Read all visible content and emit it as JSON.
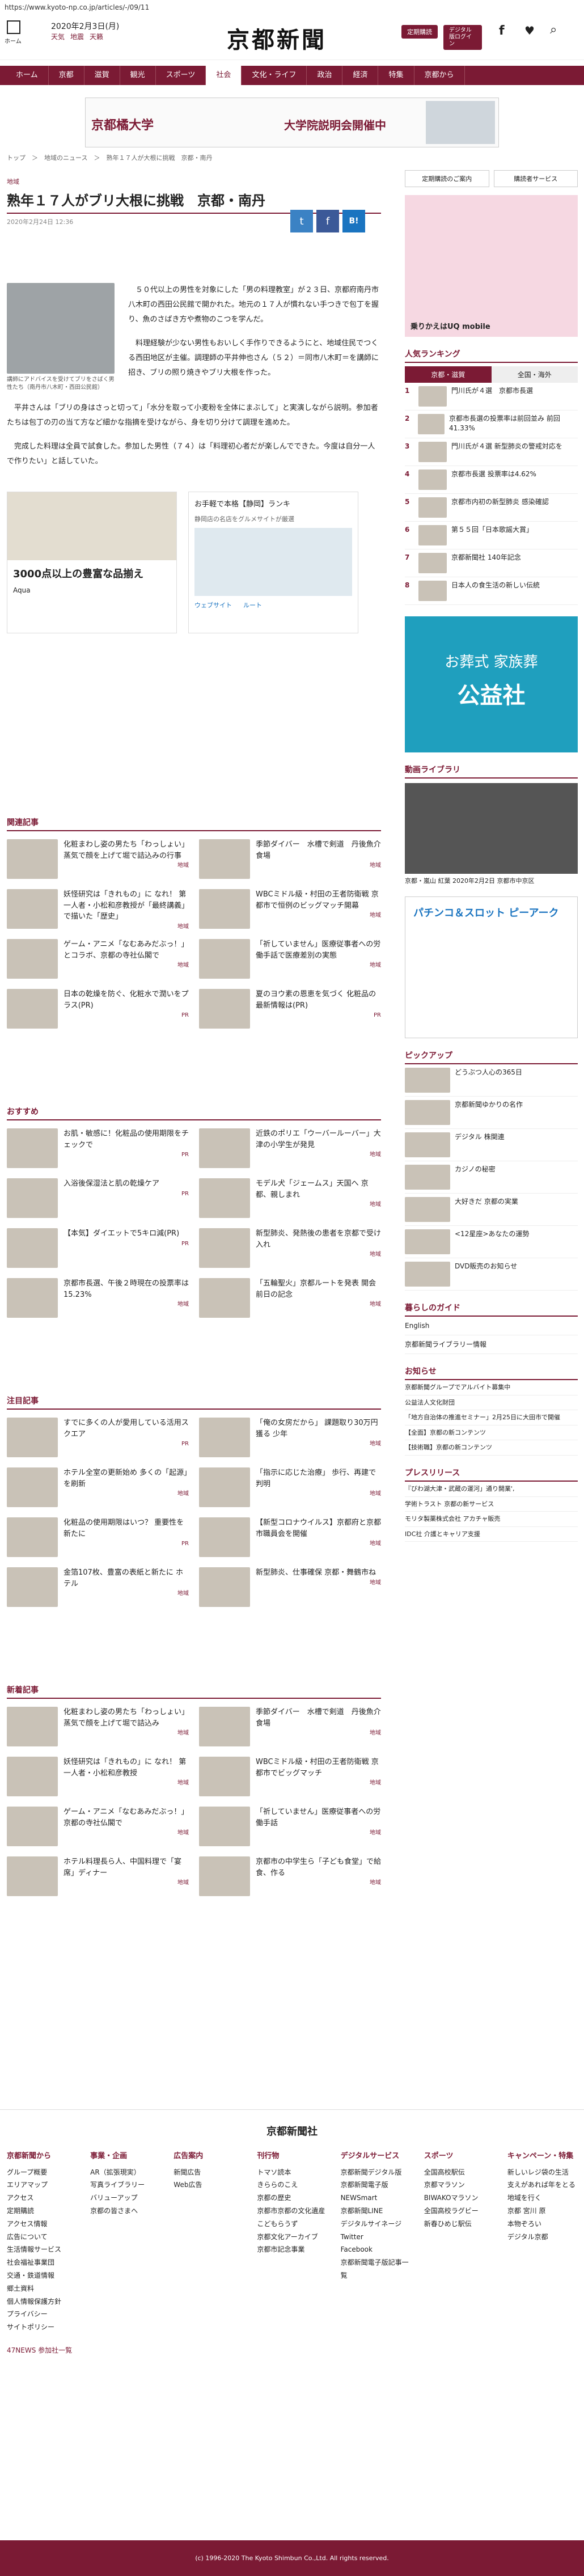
{
  "browser": {
    "url": "https://www.kyoto-np.co.jp/articles/-/09/11"
  },
  "header": {
    "date": "2020年2月3日(月)",
    "weather": [
      "天気",
      "地震",
      "天籁"
    ],
    "home_label": "ホーム",
    "brand": "京都新聞",
    "btn_subscribe": "定期購読",
    "btn_digital": "デジタル版ログイン",
    "social": [
      "Facebook",
      "Twitter",
      "Search"
    ]
  },
  "nav": {
    "items": [
      "ホーム",
      "京都",
      "滋賀",
      "観光",
      "スポーツ",
      "社会",
      "文化・ライフ",
      "政治",
      "経済",
      "特集",
      "京都から"
    ]
  },
  "banner": {
    "left": "京都橘大学",
    "middle": "大学院説明会開催中"
  },
  "breadcrumb": "トップ　＞　地域のニュース　＞　熟年１７人が大根に挑戦　京都・南丹",
  "article": {
    "category": "地域",
    "title": "熟年１７人がブリ大根に挑戦　京都・南丹",
    "date": "2020年2月24日 12:36",
    "share": [
      "f",
      "t",
      "B!"
    ],
    "photo_caption": "講師にアドバイスを受けてブリをさばく男性たち（南丹市八木町・西田公民館）",
    "paragraphs": [
      "５０代以上の男性を対象にした「男の料理教室」が２３日、京都府南丹市八木町の西田公民館で開かれた。地元の１７人が慣れない手つきで包丁を握り、魚のさばき方や煮物のこつを学んだ。",
      "料理経験が少ない男性もおいしく手作りできるようにと、地域住民でつくる西田地区が主催。調理師の平井伸也さん（５２）＝同市八木町＝を講師に招き、ブリの照り焼きやブリ大根を作った。",
      "平井さんは「ブリの身はさっと切って」「水分を取って小麦粉を全体にまぶして」と実演しながら説明。参加者たちは包丁の刃の当て方など細かな指摘を受けながら、身を切り分けて調理を進めた。",
      "完成した料理は全員で試食した。参加した男性（７４）は「料理初心者だが楽しんでできた。今度は自分一人で作りたい」と話していた。"
    ]
  },
  "ads": {
    "left_title": "3000点以上の豊富な品揃え",
    "left_brand": "Aqua",
    "right_title": "お手軽で本格【静岡】ランキ",
    "right_sub": "静岡店の名店をグルメサイトが厳選",
    "right_btn": [
      "ウェブサイト",
      "ルート"
    ]
  },
  "related": {
    "title": "関連記事",
    "items": [
      {
        "text": "化粧まわし姿の男たち「わっしょい」 蒸気で顔を上げて堀で詰込みの行事",
        "tag": "地域"
      },
      {
        "text": "季節ダイバー　水槽で剣道　丹後魚介食場",
        "tag": "地域"
      },
      {
        "text": "妖怪研究は「きれもの」に なれ！ 第一人者・小松和彦教授が「最終講義」で描いた「歴史」",
        "tag": "地域"
      },
      {
        "text": "WBCミドル級・村田の王者防衛戦 京都市で恒例のビッグマッチ開幕",
        "tag": "地域"
      },
      {
        "text": "ゲーム・アニメ「なむあみだぶっ！」 とコラボ、京都の寺社仏閣で",
        "tag": "地域"
      },
      {
        "text": "「祈していません」医療従事者への労働手話で医療差別の実態",
        "tag": "地域"
      },
      {
        "text": "日本の乾燥を防ぐ、化粧水で潤いをプラス(PR)",
        "tag": "PR"
      },
      {
        "text": "夏のヨウ素の恩恵を気づく 化粧品の最新情報は(PR)",
        "tag": "PR"
      }
    ]
  },
  "recommend": {
    "title": "おすすめ",
    "items": [
      {
        "text": "お肌・敏感に！化粧品の使用期限をチェックで",
        "tag": "PR"
      },
      {
        "text": "近鉄のポリエ「ウーバールーバー」大津の小学生が発見",
        "tag": "地域"
      },
      {
        "text": "入浴後保湿法と肌の乾燥ケア",
        "tag": "PR"
      },
      {
        "text": "モデル犬「ジェームス」天国へ 京都、親しまれ",
        "tag": "地域"
      },
      {
        "text": "【本気】ダイエットで5キロ減(PR)",
        "tag": "PR"
      },
      {
        "text": "新型肺炎、発熱後の患者を京都で受け入れ",
        "tag": "地域"
      },
      {
        "text": "京都市長選、午後２時現在の投票率は15.23%",
        "tag": "地域"
      },
      {
        "text": "「五輪聖火」京都ルートを発表 開会前日の記念",
        "tag": "地域"
      }
    ]
  },
  "featured": {
    "title": "注目記事",
    "items": [
      {
        "text": "すでに多くの人が愛用している活用スクエア",
        "tag": "PR"
      },
      {
        "text": "「俺の女房だから」 課題取り30万円獲る 少年",
        "tag": "地域"
      },
      {
        "text": "ホテル全室の更新始め 多くの「起源」を刷新",
        "tag": "地域"
      },
      {
        "text": "「指示に応じた治療」 歩行、再建で判明",
        "tag": "地域"
      },
      {
        "text": "化粧品の使用期限はいつ？ 重要性を新たに",
        "tag": "PR"
      },
      {
        "text": "【新型コロナウイルス】京都府と京都市職員会を開催",
        "tag": "地域"
      },
      {
        "text": "金箔107枚、豊富の表紙と新たに ホテル",
        "tag": "地域"
      },
      {
        "text": "新型肺炎、仕事確保 京都・舞鶴市ね",
        "tag": "地域"
      }
    ]
  },
  "latest": {
    "title": "新着記事",
    "items": [
      {
        "text": "化粧まわし姿の男たち「わっしょい」 蒸気で顔を上げて堀で詰込み",
        "tag": "地域"
      },
      {
        "text": "季節ダイバー　水槽で剣道　丹後魚介食場",
        "tag": "地域"
      },
      {
        "text": "妖怪研究は「きれもの」に なれ！ 第一人者・小松和彦教授",
        "tag": "地域"
      },
      {
        "text": "WBCミドル級・村田の王者防衛戦 京都市でビッグマッチ",
        "tag": "地域"
      },
      {
        "text": "ゲーム・アニメ「なむあみだぶっ！」 京都の寺社仏閣で",
        "tag": "地域"
      },
      {
        "text": "「祈していません」医療従事者への労働手話",
        "tag": "地域"
      },
      {
        "text": "ホテル料理長ら人、中国料理で「宴席」ディナー",
        "tag": "地域"
      },
      {
        "text": "京都市の中学生ら「子ども食堂」で給食、作る",
        "tag": "地域"
      }
    ]
  },
  "sidebar": {
    "links": [
      "定期購読のご案内",
      "購読者サービス"
    ],
    "uq_ad": "乗りかえはUQ mobile",
    "ranking_title": "人気ランキング",
    "ranking_tabs": [
      "京都・滋賀",
      "全国・海外"
    ],
    "ranking": [
      "門川氏が４選　京都市長選",
      "京都市長選の投票率は前回並み 前回41.33%",
      "門川氏が４選 新型肺炎の警戒対応を",
      "京都市長選 投票率は4.62%",
      "京都市内初の新型肺炎 感染確認",
      "第５５回「日本歌謡大賞」",
      "京都新聞社 140年記念",
      "日本人の食生活の新しい伝統"
    ],
    "funeral_ad": [
      "お葬式 家族葬",
      "公益社"
    ],
    "video_title": "動画ライブラリ",
    "video_caption": "京都・嵐山 紅葉 2020年2月2日 京都市中京区",
    "pachinko_ad": "パチンコ＆スロット ピーアーク",
    "pickup_title": "ピックアップ",
    "pickup": [
      "どうぶつ人心の365日",
      "京都新聞ゆかりの名作",
      "デジタル 株関連",
      "カジノの秘密",
      "大好きだ 京都の実業",
      "<12星座>あなたの運勢",
      "DVD販売のお知らせ"
    ],
    "guide_title": "暮らしのガイド",
    "guide": [
      "English",
      "京都新聞ライブラリー情報"
    ],
    "news_title": "お知らせ",
    "news": [
      "京都新聞グループでアルバイト募集中",
      "公益法人文化財団",
      "「地方自治体の推進セミナー」2月25日に大田市で開催",
      "【全面】京都の新コンテンツ",
      "【技術職】京都の新コンテンツ"
    ],
    "release_title": "プレスリリース",
    "release": [
      "『びわ湖大津・武蔵の運河」通り開業',",
      "学術トラスト 京都の新サービス",
      "モリタ製薬株式会社 アカチャ販売",
      "IDC社 介護とキャリア支援"
    ]
  },
  "footer": {
    "brand": "京都新聞社",
    "cols": [
      {
        "title": "京都新聞から",
        "items": [
          "グループ概要",
          "エリアマップ",
          "アクセス",
          "定期購読",
          "アクセス情報",
          "広告について",
          "生活情報サービス",
          "社会福祉事業団",
          "交通・鉄道情報",
          "郷土資料",
          "個人情報保護方針",
          "プライバシー",
          "サイトポリシー"
        ]
      },
      {
        "title": "事業・企画",
        "items": [
          "AR（拡張現実）",
          "写真ライブラリー",
          "バリューアップ",
          "京都の皆さまへ"
        ]
      },
      {
        "title": "広告案内",
        "items": [
          "新聞広告",
          "Web広告"
        ]
      },
      {
        "title": "刊行物",
        "items": [
          "トマソ読本",
          "きららのこえ",
          "京都の歴史",
          "京都市京都の文化遺産",
          "こどもらうず",
          "京都文化アーカイブ",
          "京都市記念事業"
        ]
      },
      {
        "title": "デジタルサービス",
        "items": [
          "京都新聞デジタル版",
          "京都新聞電子版",
          "NEWSmart",
          "京都新聞LINE",
          "デジタルサイネージ",
          "Twitter",
          "Facebook",
          "京都新聞電子版記事一覧"
        ]
      },
      {
        "title": "スポーツ",
        "items": [
          "全国高校駅伝",
          "京都マラソン",
          "BIWAKOマラソン",
          "全国高校ラグビー",
          "新春ひめじ駅伝"
        ]
      },
      {
        "title": "キャンペーン・特集",
        "items": [
          "新しいレジ袋の生活",
          "支えがあれば年をとる",
          "地域を行く",
          "京都 宮川 原",
          "本物ぞろい",
          "デジタル京都"
        ]
      }
    ],
    "partners_label": "47NEWS 参加社一覧",
    "copyright": "(c) 1996-2020 The Kyoto Shimbun Co.,Ltd. All rights reserved."
  }
}
